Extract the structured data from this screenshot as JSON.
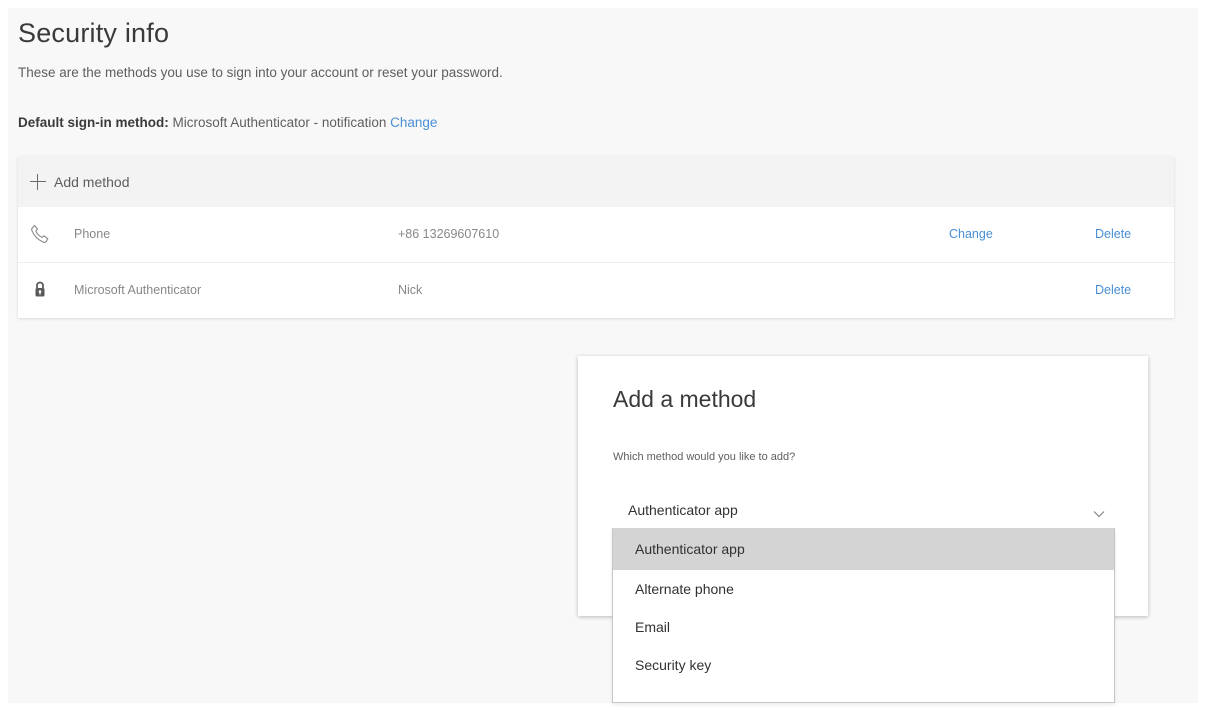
{
  "page": {
    "title": "Security info",
    "subtitle": "These are the methods you use to sign into your account or reset your password.",
    "default_label": "Default sign-in method:",
    "default_value": "Microsoft Authenticator - notification",
    "default_change": "Change"
  },
  "methods": {
    "add_label": "Add method",
    "rows": [
      {
        "icon": "phone-icon",
        "name": "Phone",
        "value": "+86 13269607610",
        "change": "Change",
        "delete": "Delete"
      },
      {
        "icon": "lock-icon",
        "name": "Microsoft Authenticator",
        "value": "Nick",
        "delete": "Delete"
      }
    ]
  },
  "dialog": {
    "title": "Add a method",
    "question": "Which method would you like to add?",
    "selected": "Authenticator app",
    "options": [
      "Authenticator app",
      "Alternate phone",
      "Email",
      "Security key"
    ]
  },
  "colors": {
    "link": "#4a8fd6",
    "selected_option_bg": "#d4d4d4"
  }
}
